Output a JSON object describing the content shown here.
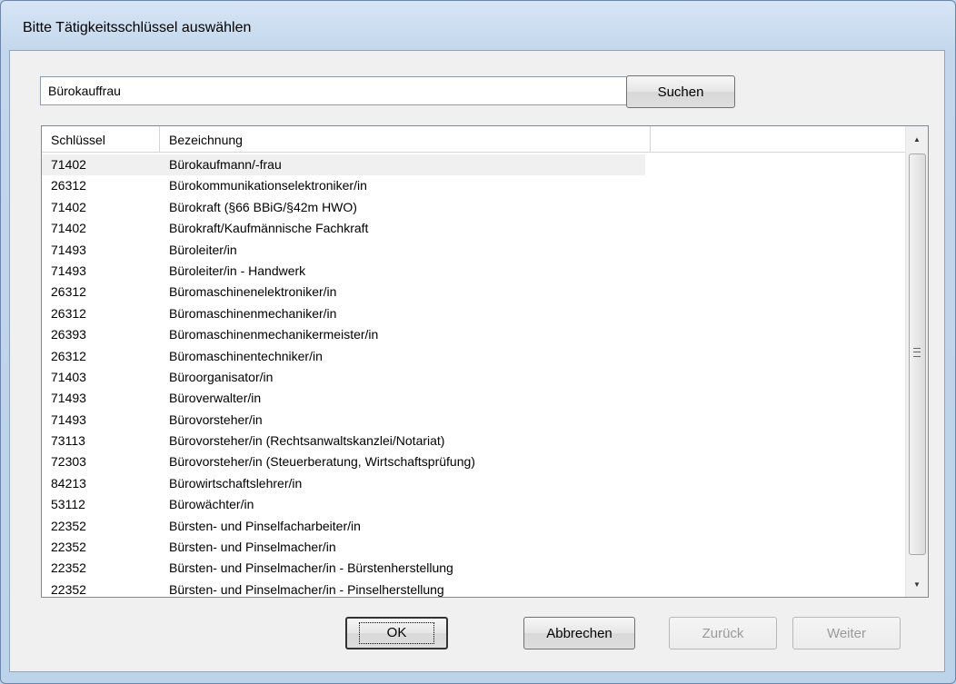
{
  "window": {
    "title": "Bitte Tätigkeitsschlüssel auswählen"
  },
  "search": {
    "value": "Bürokauffrau",
    "button_label": "Suchen"
  },
  "list": {
    "columns": [
      "Schlüssel",
      "Bezeichnung"
    ],
    "rows": [
      {
        "key": "71402",
        "name": "Bürokaufmann/-frau"
      },
      {
        "key": "26312",
        "name": "Bürokommunikationselektroniker/in"
      },
      {
        "key": "71402",
        "name": "Bürokraft (§66 BBiG/§42m HWO)"
      },
      {
        "key": "71402",
        "name": "Bürokraft/Kaufmännische Fachkraft"
      },
      {
        "key": "71493",
        "name": "Büroleiter/in"
      },
      {
        "key": "71493",
        "name": "Büroleiter/in - Handwerk"
      },
      {
        "key": "26312",
        "name": "Büromaschinenelektroniker/in"
      },
      {
        "key": "26312",
        "name": "Büromaschinenmechaniker/in"
      },
      {
        "key": "26393",
        "name": "Büromaschinenmechanikermeister/in"
      },
      {
        "key": "26312",
        "name": "Büromaschinentechniker/in"
      },
      {
        "key": "71403",
        "name": "Büroorganisator/in"
      },
      {
        "key": "71493",
        "name": "Büroverwalter/in"
      },
      {
        "key": "71493",
        "name": "Bürovorsteher/in"
      },
      {
        "key": "73113",
        "name": "Bürovorsteher/in (Rechtsanwaltskanzlei/Notariat)"
      },
      {
        "key": "72303",
        "name": "Bürovorsteher/in (Steuerberatung, Wirtschaftsprüfung)"
      },
      {
        "key": "84213",
        "name": "Bürowirtschaftslehrer/in"
      },
      {
        "key": "53112",
        "name": "Bürowächter/in"
      },
      {
        "key": "22352",
        "name": "Bürsten- und Pinselfacharbeiter/in"
      },
      {
        "key": "22352",
        "name": "Bürsten- und Pinselmacher/in"
      },
      {
        "key": "22352",
        "name": "Bürsten- und Pinselmacher/in - Bürstenherstellung"
      },
      {
        "key": "22352",
        "name": "Bürsten- und Pinselmacher/in - Pinselherstellung"
      }
    ]
  },
  "buttons": {
    "ok": "OK",
    "cancel": "Abbrechen",
    "back": "Zurück",
    "next": "Weiter"
  }
}
